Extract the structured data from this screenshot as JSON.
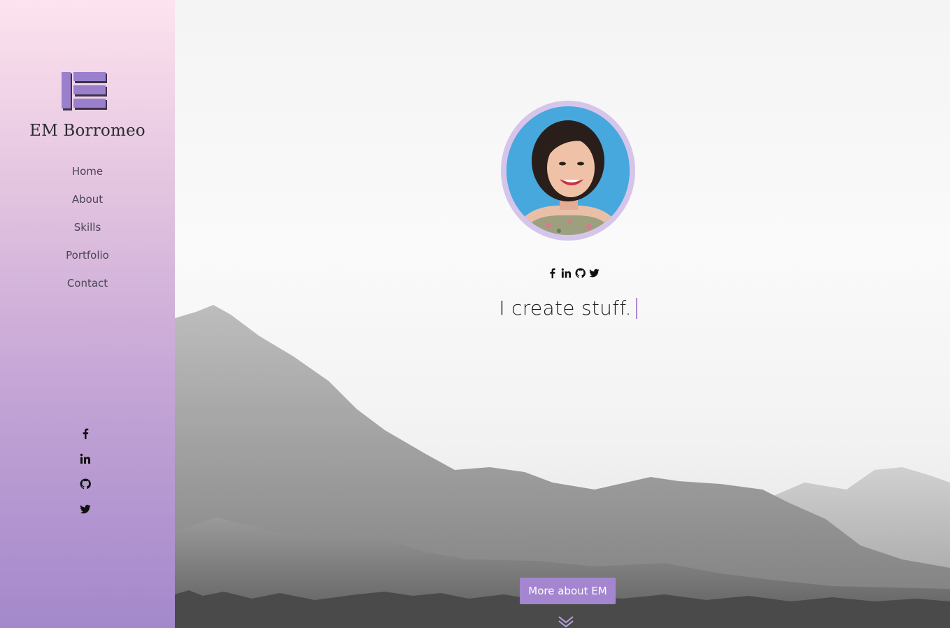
{
  "brand": {
    "name": "EM Borromeo",
    "logo_icon": "stacked-bars-logo",
    "accent": "#a386cf"
  },
  "nav": {
    "items": [
      {
        "label": "Home"
      },
      {
        "label": "About"
      },
      {
        "label": "Skills"
      },
      {
        "label": "Portfolio"
      },
      {
        "label": "Contact"
      }
    ]
  },
  "sidebar_social": [
    "facebook-icon",
    "linkedin-icon",
    "github-icon",
    "twitter-icon"
  ],
  "hero": {
    "social": [
      "facebook-icon",
      "linkedin-icon",
      "github-icon",
      "twitter-icon"
    ],
    "tagline": "I create stuff.",
    "cta_label": "More about EM",
    "scroll_icon": "double-chevron-down-icon"
  }
}
